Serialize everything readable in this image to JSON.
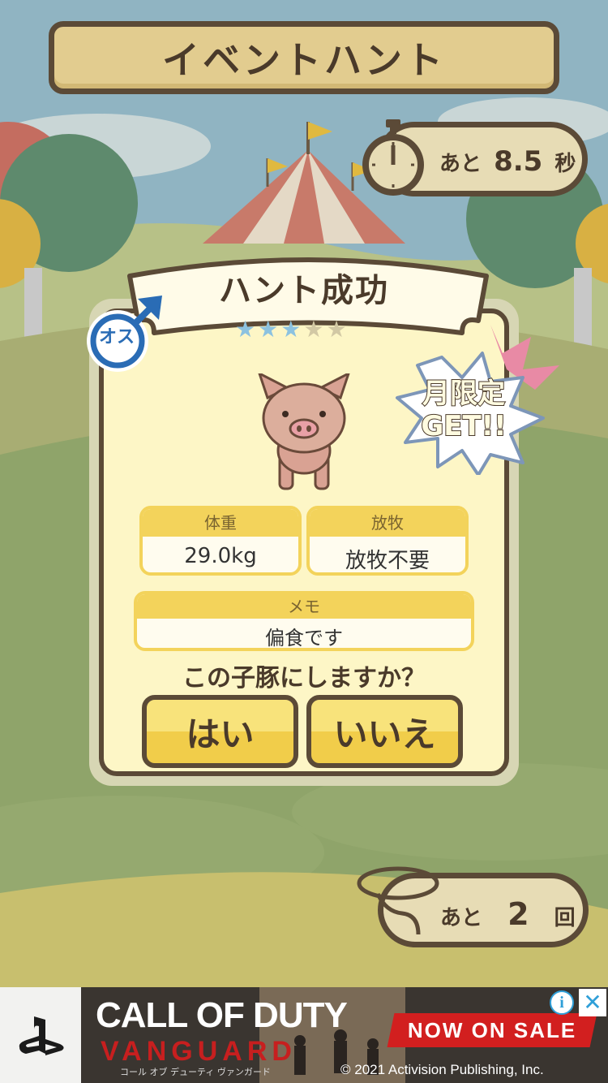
{
  "header": {
    "title": "イベントハント"
  },
  "timer": {
    "prefix": "あと",
    "value": "8.5",
    "unit": "秒",
    "icon": "stopwatch-icon"
  },
  "dialog": {
    "title": "ハント成功",
    "gender_label": "オス",
    "gender_icon": "male-icon",
    "stars": {
      "filled": 3,
      "total": 5
    },
    "badge_line1": "月限定",
    "badge_line2": "GET!!",
    "weight": {
      "label": "体重",
      "value": "29.0kg"
    },
    "grazing": {
      "label": "放牧",
      "value": "放牧不要"
    },
    "memo": {
      "label": "メモ",
      "value": "偏食です"
    },
    "question": "この子豚にしますか？",
    "yes_label": "はい",
    "no_label": "いいえ"
  },
  "remaining": {
    "prefix": "あと",
    "value": "2",
    "unit": "回",
    "icon": "lasso-icon"
  },
  "ad": {
    "title_line1": "CALL OF DUTY",
    "title_line2": "VANGUARD",
    "subtitle": "コール オブ デューティ ヴァンガード",
    "cta": "NOW ON SALE",
    "copyright": "© 2021 Activision Publishing, Inc.",
    "info_glyph": "i",
    "close_glyph": "✕"
  },
  "colors": {
    "wood": "#e2cc8f",
    "outline": "#5b4a37",
    "card": "#fdf6c6",
    "button": "#f3d35b",
    "ad_red": "#d21f1f"
  }
}
